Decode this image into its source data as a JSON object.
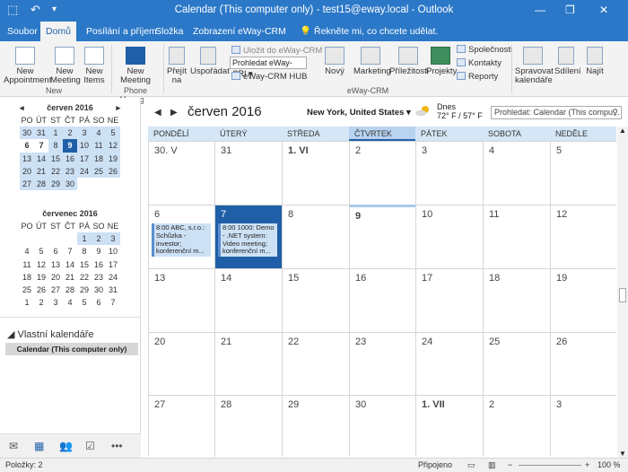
{
  "titlebar": {
    "title": "Calendar (This computer only) - test15@eway.local - Outlook",
    "min": "—",
    "restore": "❐",
    "close": "✕",
    "undo": "↶",
    "save": "⬚",
    "more": "▾"
  },
  "tabs": [
    "Soubor",
    "Domů",
    "Posílání a příjem",
    "Složka",
    "Zobrazení",
    "eWay-CRM"
  ],
  "tell_me": "Řekněte mi, co chcete udělat.",
  "ribbon": {
    "new_appointment": "New Appointment",
    "new_meeting": "New Meeting",
    "new_items": "New Items",
    "group_new": "New",
    "new_meeting2": "New Meeting",
    "group_phone": "Phone Manager",
    "go_to": "Přejít na",
    "arrange": "Uspořádat",
    "save_to_eway": "Uložit do eWay-CRM",
    "search_eway": "Prohledat eWay-CRI",
    "eway_hub": "eWay-CRM HUB",
    "new": "Nový",
    "marketing": "Marketing",
    "opportunities": "Příležitosti",
    "projects": "Projekty",
    "companies": "Společnosti",
    "contacts": "Kontakty",
    "reports": "Reporty",
    "group_eway": "eWay-CRM",
    "manage_calendars": "Spravovat kalendáře",
    "share": "Sdílení",
    "find": "Najít"
  },
  "mini_june": {
    "title": "červen 2016",
    "days": [
      "PO",
      "ÚT",
      "ST",
      "ČT",
      "PÁ",
      "SO",
      "NE"
    ],
    "weeks": [
      [
        "30",
        "31",
        "1",
        "2",
        "3",
        "4",
        "5"
      ],
      [
        "6",
        "7",
        "8",
        "9",
        "10",
        "11",
        "12"
      ],
      [
        "13",
        "14",
        "15",
        "16",
        "17",
        "18",
        "19"
      ],
      [
        "20",
        "21",
        "22",
        "23",
        "24",
        "25",
        "26"
      ],
      [
        "27",
        "28",
        "29",
        "30",
        "",
        "",
        ""
      ]
    ]
  },
  "mini_july": {
    "title": "červenec 2016",
    "days": [
      "PO",
      "ÚT",
      "ST",
      "ČT",
      "PÁ",
      "SO",
      "NE"
    ],
    "weeks": [
      [
        "",
        "",
        "",
        "",
        "1",
        "2",
        "3"
      ],
      [
        "4",
        "5",
        "6",
        "7",
        "8",
        "9",
        "10"
      ],
      [
        "11",
        "12",
        "13",
        "14",
        "15",
        "16",
        "17"
      ],
      [
        "18",
        "19",
        "20",
        "21",
        "22",
        "23",
        "24"
      ],
      [
        "25",
        "26",
        "27",
        "28",
        "29",
        "30",
        "31"
      ],
      [
        "1",
        "2",
        "3",
        "4",
        "5",
        "6",
        "7"
      ]
    ]
  },
  "own_calendars": "Vlastní kalendáře",
  "own_calendar_item": "Calendar (This computer only)",
  "calendar": {
    "month": "červen 2016",
    "location": "New York, United States",
    "weather_label": "Dnes",
    "weather_temp": "72° F / 57° F",
    "search_placeholder": "Prohledat: Calendar (This compu...",
    "weekdays": [
      "PONDĚLÍ",
      "ÚTERÝ",
      "STŘEDA",
      "ČTVRTEK",
      "PÁTEK",
      "SOBOTA",
      "NEDĚLE"
    ],
    "weeks": [
      [
        "30. V",
        "31",
        "1. VI",
        "2",
        "3",
        "4",
        "5"
      ],
      [
        "6",
        "7",
        "8",
        "9",
        "10",
        "11",
        "12"
      ],
      [
        "13",
        "14",
        "15",
        "16",
        "17",
        "18",
        "19"
      ],
      [
        "20",
        "21",
        "22",
        "23",
        "24",
        "25",
        "26"
      ],
      [
        "27",
        "28",
        "29",
        "30",
        "1. VII",
        "2",
        "3"
      ]
    ],
    "events": [
      {
        "day": "6",
        "text": "8:00 ABC, s.r.o.: Schůzka - investor; konferenční m..."
      },
      {
        "day": "7",
        "text": "8:00 1000: Demo - .NET system: Video meeting; konferenční m..."
      }
    ]
  },
  "status": {
    "items": "Položky: 2",
    "connection": "Připojeno",
    "zoom": "100 %"
  }
}
